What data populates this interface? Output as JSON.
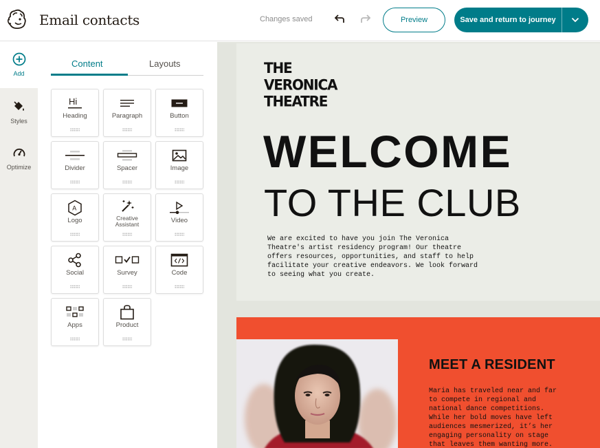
{
  "header": {
    "title": "Email contacts",
    "status": "Changes saved",
    "preview_label": "Preview",
    "save_label": "Save and return to journey"
  },
  "rail": {
    "items": [
      {
        "label": "Add",
        "icon": "plus-circle-icon"
      },
      {
        "label": "Styles",
        "icon": "paint-bucket-icon"
      },
      {
        "label": "Optimize",
        "icon": "gauge-icon"
      }
    ]
  },
  "panel": {
    "tabs": [
      {
        "label": "Content",
        "selected": true
      },
      {
        "label": "Layouts",
        "selected": false
      }
    ],
    "blocks": [
      {
        "label": "Heading",
        "icon": "heading-icon"
      },
      {
        "label": "Paragraph",
        "icon": "paragraph-icon"
      },
      {
        "label": "Button",
        "icon": "button-icon"
      },
      {
        "label": "Divider",
        "icon": "divider-icon"
      },
      {
        "label": "Spacer",
        "icon": "spacer-icon"
      },
      {
        "label": "Image",
        "icon": "image-icon"
      },
      {
        "label": "Logo",
        "icon": "logo-icon"
      },
      {
        "label": "Creative Assistant",
        "icon": "magic-wand-icon"
      },
      {
        "label": "Video",
        "icon": "video-icon"
      },
      {
        "label": "Social",
        "icon": "share-icon"
      },
      {
        "label": "Survey",
        "icon": "survey-icon"
      },
      {
        "label": "Code",
        "icon": "code-icon"
      },
      {
        "label": "Apps",
        "icon": "apps-icon"
      },
      {
        "label": "Product",
        "icon": "shopping-bag-icon"
      }
    ],
    "heading_icon_text": "Hi",
    "logo_icon_text": "A"
  },
  "email": {
    "brand_lines": [
      "THE",
      "VERONICA",
      "THEATRE"
    ],
    "welcome": "WELCOME",
    "to_the_club": "TO THE CLUB",
    "intro_lines": [
      "We are excited to have you join The Veronica",
      "Theatre's artist residency program! Our theatre",
      "offers resources, opportunities, and staff to help",
      "facilitate your creative endeavors. We look forward",
      "to seeing what you create."
    ],
    "resident_heading": "MEET A RESIDENT",
    "resident_bio_lines": [
      "Maria has traveled near and far",
      "to compete in regional and",
      "national dance competitions.",
      "While her bold moves have left",
      "audiences mesmerized, it’s her",
      "engaging personality on stage",
      "that leaves them wanting more."
    ]
  },
  "colors": {
    "accent": "#007c89",
    "resident_bg": "#f04f2f",
    "hero_bg": "#ebede7",
    "canvas_bg": "#e3e5de"
  }
}
